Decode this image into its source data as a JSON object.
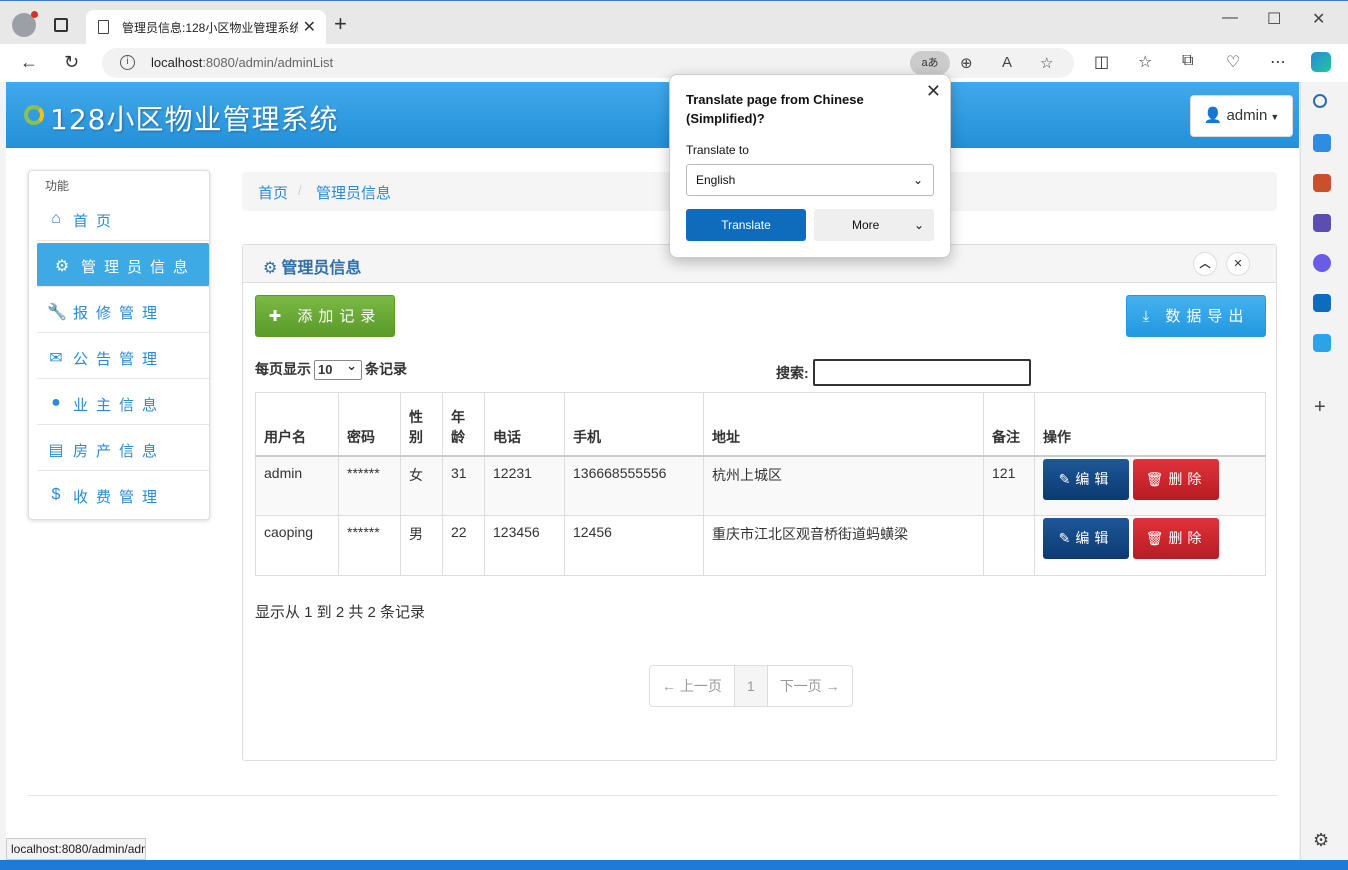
{
  "browser": {
    "tab_title": "管理员信息:128小区物业管理系统",
    "url_host": "localhost",
    "url_rest": ":8080/admin/adminList",
    "translate_badge": "aあ",
    "status_url": "localhost:8080/admin/adminList"
  },
  "app": {
    "title": "128小区物业管理系统",
    "user_label": "admin"
  },
  "sidebar": {
    "label": "功能",
    "items": [
      {
        "label": "首页",
        "icon": "home-icon"
      },
      {
        "label": "管理员信息",
        "icon": "gear-icon"
      },
      {
        "label": "报修管理",
        "icon": "wrench-icon"
      },
      {
        "label": "公告管理",
        "icon": "envelope-icon"
      },
      {
        "label": "业主信息",
        "icon": "user-icon"
      },
      {
        "label": "房产信息",
        "icon": "list-icon"
      },
      {
        "label": "收费管理",
        "icon": "dollar-icon"
      }
    ]
  },
  "breadcrumb": {
    "home": "首页",
    "current": "管理员信息"
  },
  "panel": {
    "title": "管理员信息",
    "add_label": "添加记录",
    "export_label": "数据导出",
    "page_size_prefix": "每页显示",
    "page_size_value": "10",
    "page_size_suffix": "条记录",
    "search_label": "搜索:",
    "info_text": "显示从 1 到 2 共 2 条记录"
  },
  "table": {
    "headers": [
      "用户名",
      "密码",
      "性别",
      "年龄",
      "电话",
      "手机",
      "地址",
      "备注",
      "操作"
    ],
    "rows": [
      [
        "admin",
        "******",
        "女",
        "31",
        "12231",
        "136668555556",
        "杭州上城区",
        "121"
      ],
      [
        "caoping",
        "******",
        "男",
        "22",
        "123456",
        "12456",
        "重庆市江北区观音桥街道蚂蟥梁",
        ""
      ]
    ],
    "edit_label": "编辑",
    "delete_label": "删除"
  },
  "pagination": {
    "prev": "← 上一页",
    "current": "1",
    "next": "下一页 →"
  },
  "translate_popup": {
    "title": "Translate page from Chinese (Simplified)?",
    "to_label": "Translate to",
    "language": "English",
    "translate_btn": "Translate",
    "more_btn": "More"
  }
}
